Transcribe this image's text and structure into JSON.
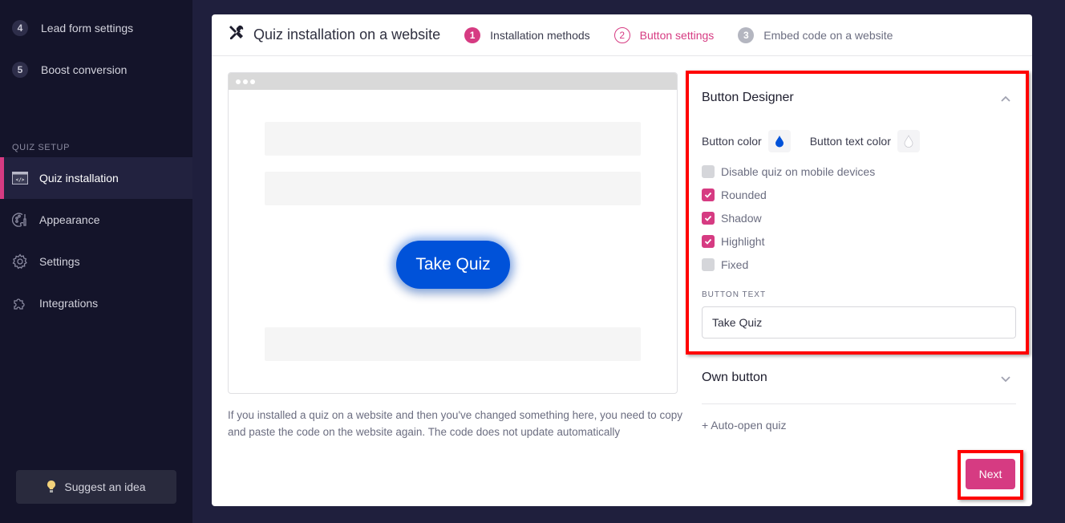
{
  "sidebar": {
    "steps": [
      {
        "number": "4",
        "label": "Lead form settings"
      },
      {
        "number": "5",
        "label": "Boost conversion"
      }
    ],
    "section_title": "QUIZ SETUP",
    "nav": [
      {
        "label": "Quiz installation",
        "icon": "code-window-icon",
        "active": true
      },
      {
        "label": "Appearance",
        "icon": "palette-icon",
        "active": false
      },
      {
        "label": "Settings",
        "icon": "gear-icon",
        "active": false
      },
      {
        "label": "Integrations",
        "icon": "puzzle-icon",
        "active": false
      }
    ],
    "suggest_label": "Suggest an idea"
  },
  "header": {
    "title": "Quiz installation on a website",
    "steps": [
      {
        "number": "1",
        "label": "Installation methods",
        "state": "done"
      },
      {
        "number": "2",
        "label": "Button settings",
        "state": "current"
      },
      {
        "number": "3",
        "label": "Embed code on a website",
        "state": "todo"
      }
    ]
  },
  "preview": {
    "button_label": "Take Quiz",
    "button_color": "#0052d9",
    "button_text_color": "#ffffff"
  },
  "note": "If you installed a quiz on a website and then you've changed something here, you need to copy and paste the code on the website again. The code does not update automatically",
  "designer": {
    "title": "Button Designer",
    "button_color_label": "Button color",
    "button_text_color_label": "Button text color",
    "options": [
      {
        "label": "Disable quiz on mobile devices",
        "checked": false
      },
      {
        "label": "Rounded",
        "checked": true
      },
      {
        "label": "Shadow",
        "checked": true
      },
      {
        "label": "Highlight",
        "checked": true
      },
      {
        "label": "Fixed",
        "checked": false
      }
    ],
    "button_text_label": "BUTTON TEXT",
    "button_text_value": "Take Quiz"
  },
  "own_button_label": "Own button",
  "auto_open_label": "+ Auto-open quiz",
  "next_label": "Next",
  "colors": {
    "accent": "#d63b82",
    "sidebar_bg": "#14142a",
    "page_bg": "#1f1f3d",
    "highlight_outline": "#ff0000"
  }
}
